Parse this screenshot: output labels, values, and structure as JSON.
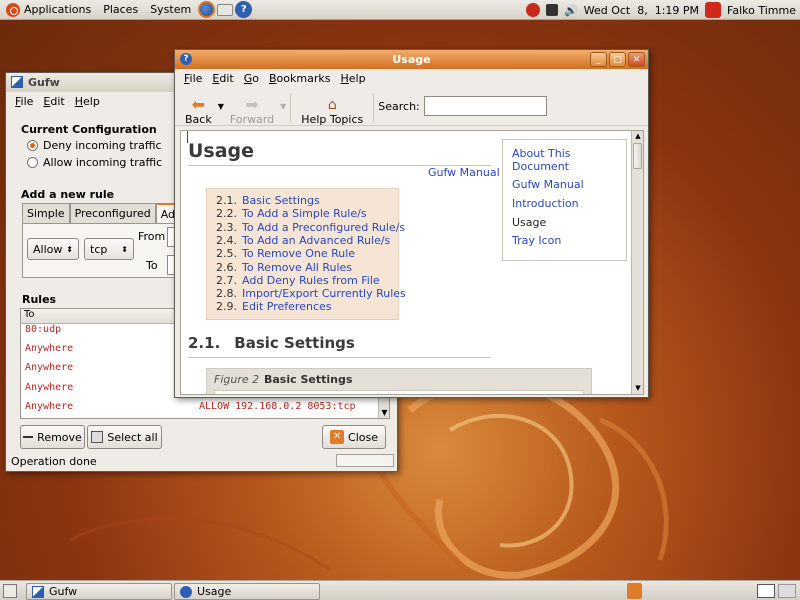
{
  "top_panel": {
    "menus": [
      "Applications",
      "Places",
      "System"
    ],
    "clock": "Wed Oct  8,  1:19 PM",
    "user": "Falko Timme"
  },
  "gufw": {
    "title": "Gufw",
    "menu": [
      "File",
      "Edit",
      "Help"
    ],
    "current_config_heading": "Current Configuration",
    "deny_label": "Deny incoming traffic",
    "allow_label": "Allow incoming traffic",
    "deny_selected": true,
    "add_rule_heading": "Add a new rule",
    "tabs": [
      "Simple",
      "Preconfigured",
      "Advanced"
    ],
    "active_tab": "Advanced",
    "action_value": "Allow",
    "protocol_value": "tcp",
    "from_label": "From",
    "to_label": "To",
    "rules_heading": "Rules",
    "rules_column": "To",
    "rules": [
      "80:udp",
      "Anywhere",
      "Anywhere",
      "Anywhere",
      "Anywhere"
    ],
    "last_rule_detail": "ALLOW 192.168.0.2 8053:tcp",
    "remove_label": "Remove",
    "select_all_label": "Select all",
    "close_label": "Close",
    "status": "Operation done"
  },
  "help": {
    "title": "Usage",
    "menu": [
      "File",
      "Edit",
      "Go",
      "Bookmarks",
      "Help"
    ],
    "back_label": "Back",
    "forward_label": "Forward",
    "help_topics_label": "Help Topics",
    "search_label": "Search:",
    "search_value": "",
    "page_title": "Usage",
    "gufw_manual_link": "Gufw Manual",
    "toc": [
      {
        "num": "2.1.",
        "label": "Basic Settings"
      },
      {
        "num": "2.2.",
        "label": "To Add a Simple Rule/s"
      },
      {
        "num": "2.3.",
        "label": "To Add a Preconfigured Rule/s"
      },
      {
        "num": "2.4.",
        "label": "To Add an Advanced Rule/s"
      },
      {
        "num": "2.5.",
        "label": "To Remove One Rule"
      },
      {
        "num": "2.6.",
        "label": "To Remove All Rules"
      },
      {
        "num": "2.7.",
        "label": "Add Deny Rules from File"
      },
      {
        "num": "2.8.",
        "label": "Import/Export Currently Rules"
      },
      {
        "num": "2.9.",
        "label": "Edit Preferences"
      }
    ],
    "sidebar": [
      "About This Document",
      "Gufw Manual",
      "Introduction",
      "Usage",
      "Tray Icon"
    ],
    "sidebar_current": "Usage",
    "section_num": "2.1.",
    "section_title": "Basic Settings",
    "figure_label": "Figure 2",
    "figure_title": "Basic Settings"
  },
  "bottom_panel": {
    "tasks": [
      "Gufw",
      "Usage"
    ]
  },
  "colors": {
    "accent": "#e07b2a",
    "link": "#2747c6",
    "rule_text": "#c0261c"
  }
}
